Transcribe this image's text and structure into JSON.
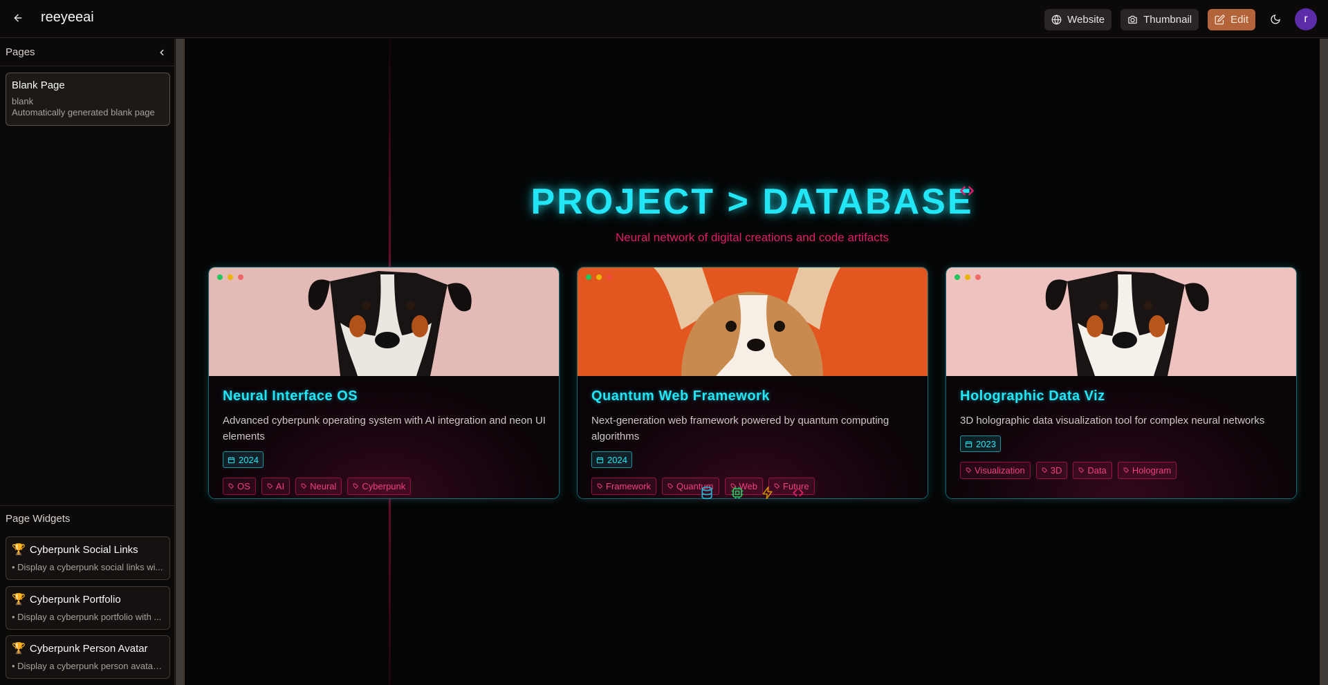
{
  "header": {
    "title": "reeyeeai",
    "website_label": "Website",
    "thumbnail_label": "Thumbnail",
    "edit_label": "Edit",
    "avatar_initial": "r"
  },
  "sidebar": {
    "pages_title": "Pages",
    "pages": [
      {
        "title": "Blank Page",
        "slug": "blank",
        "description": "Automatically generated blank page"
      }
    ],
    "widgets_title": "Page Widgets",
    "widgets": [
      {
        "title": "Cyberpunk Social Links",
        "description": "• Display a cyberpunk social links wi..."
      },
      {
        "title": "Cyberpunk Portfolio",
        "description": "• Display a cyberpunk portfolio with ..."
      },
      {
        "title": "Cyberpunk Person Avatar",
        "description": "• Display a cyberpunk person avatar ..."
      }
    ]
  },
  "main": {
    "heading": "PROJECT > DATABASE",
    "subtitle": "Neural network of digital creations and code artifacts",
    "projects": [
      {
        "title": "Neural Interface OS",
        "description": "Advanced cyberpunk operating system with AI integration and neon UI elements",
        "year": "2024",
        "tags": [
          "OS",
          "AI",
          "Neural",
          "Cyberpunk"
        ],
        "image": "black-white-tan-dog-on-pink"
      },
      {
        "title": "Quantum Web Framework",
        "description": "Next-generation web framework powered by quantum computing algorithms",
        "year": "2024",
        "tags": [
          "Framework",
          "Quantum",
          "Web",
          "Future"
        ],
        "image": "corgi-puppy-on-orange"
      },
      {
        "title": "Holographic Data Viz",
        "description": "3D holographic data visualization tool for complex neural networks",
        "year": "2023",
        "tags": [
          "Visualization",
          "3D",
          "Data",
          "Hologram"
        ],
        "image": "black-white-tan-dog-on-pink"
      }
    ],
    "footer_icons": [
      "database-icon",
      "cpu-icon",
      "zap-icon",
      "code-icon"
    ]
  },
  "colors": {
    "accent_cyan": "#22e5f5",
    "accent_pink": "#e11d6a",
    "edit_button": "#b4643a",
    "avatar": "#5b2ca8"
  }
}
